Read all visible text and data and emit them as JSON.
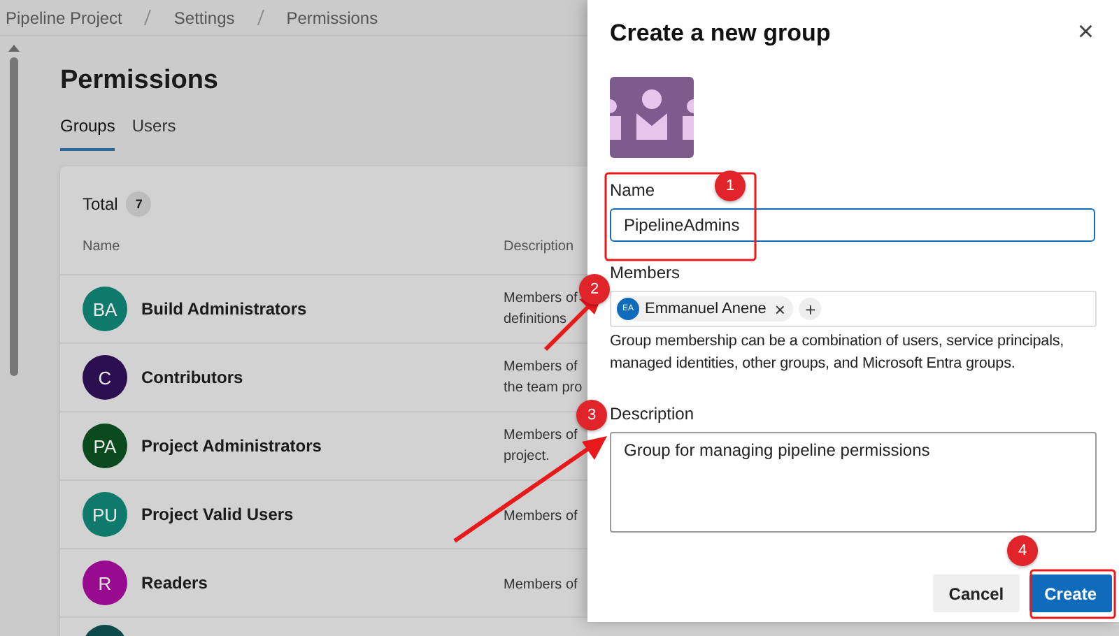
{
  "breadcrumb": [
    "Pipeline Project",
    "Settings",
    "Permissions"
  ],
  "page": {
    "title": "Permissions"
  },
  "tabs": [
    {
      "label": "Groups",
      "selected": true
    },
    {
      "label": "Users",
      "selected": false
    }
  ],
  "groups_table": {
    "total_label": "Total",
    "total_count": "7",
    "columns": [
      "Name",
      "Description"
    ],
    "rows": [
      {
        "initials": "BA",
        "color": "#0e7a6c",
        "name": "Build Administrators",
        "description": [
          "Members of",
          "definitions"
        ]
      },
      {
        "initials": "C",
        "color": "#2b0f4e",
        "name": "Contributors",
        "description": [
          "Members of",
          "the team pro"
        ]
      },
      {
        "initials": "PA",
        "color": "#0b4a1e",
        "name": "Project Administrators",
        "description": [
          "Members of",
          "project."
        ]
      },
      {
        "initials": "PU",
        "color": "#0e7a6c",
        "name": "Project Valid Users",
        "description": [
          "Members of"
        ]
      },
      {
        "initials": "R",
        "color": "#980a8e",
        "name": "Readers",
        "description": [
          "Members of"
        ]
      }
    ]
  },
  "dialog": {
    "title": "Create a new group",
    "close": "×",
    "name": {
      "label": "Name",
      "value": "PipelineAdmins"
    },
    "members": {
      "label": "Members",
      "chips": [
        {
          "initials": "EA",
          "name": "Emmanuel Anene",
          "remove": "×"
        }
      ],
      "add": "+",
      "help": "Group membership can be a combination of users, service principals, managed identities, other groups, and Microsoft Entra groups."
    },
    "description": {
      "label": "Description",
      "value": "Group for managing pipeline permissions"
    },
    "buttons": [
      {
        "label": "Cancel",
        "kind": "secondary"
      },
      {
        "label": "Create",
        "kind": "primary"
      }
    ]
  },
  "annotations": [
    {
      "number": "1"
    },
    {
      "number": "2"
    },
    {
      "number": "3"
    },
    {
      "number": "4"
    }
  ]
}
